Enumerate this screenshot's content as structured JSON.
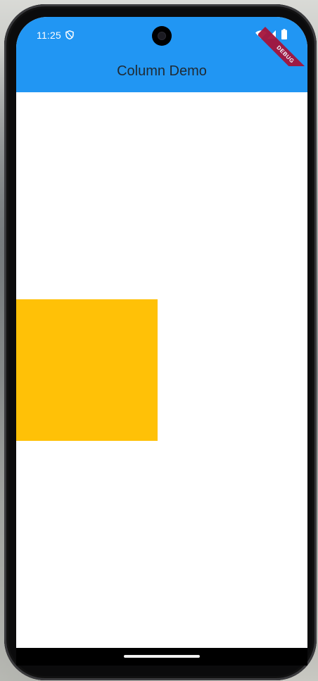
{
  "status_bar": {
    "time": "11:25",
    "icons": [
      "shield-icon",
      "wifi-icon",
      "signal-icon",
      "battery-icon"
    ]
  },
  "app_bar": {
    "title": "Column Demo",
    "background_color": "#2196f3"
  },
  "debug_banner": {
    "label": "DEBUG",
    "color": "#a5143a"
  },
  "content": {
    "box_color": "#ffc107"
  }
}
